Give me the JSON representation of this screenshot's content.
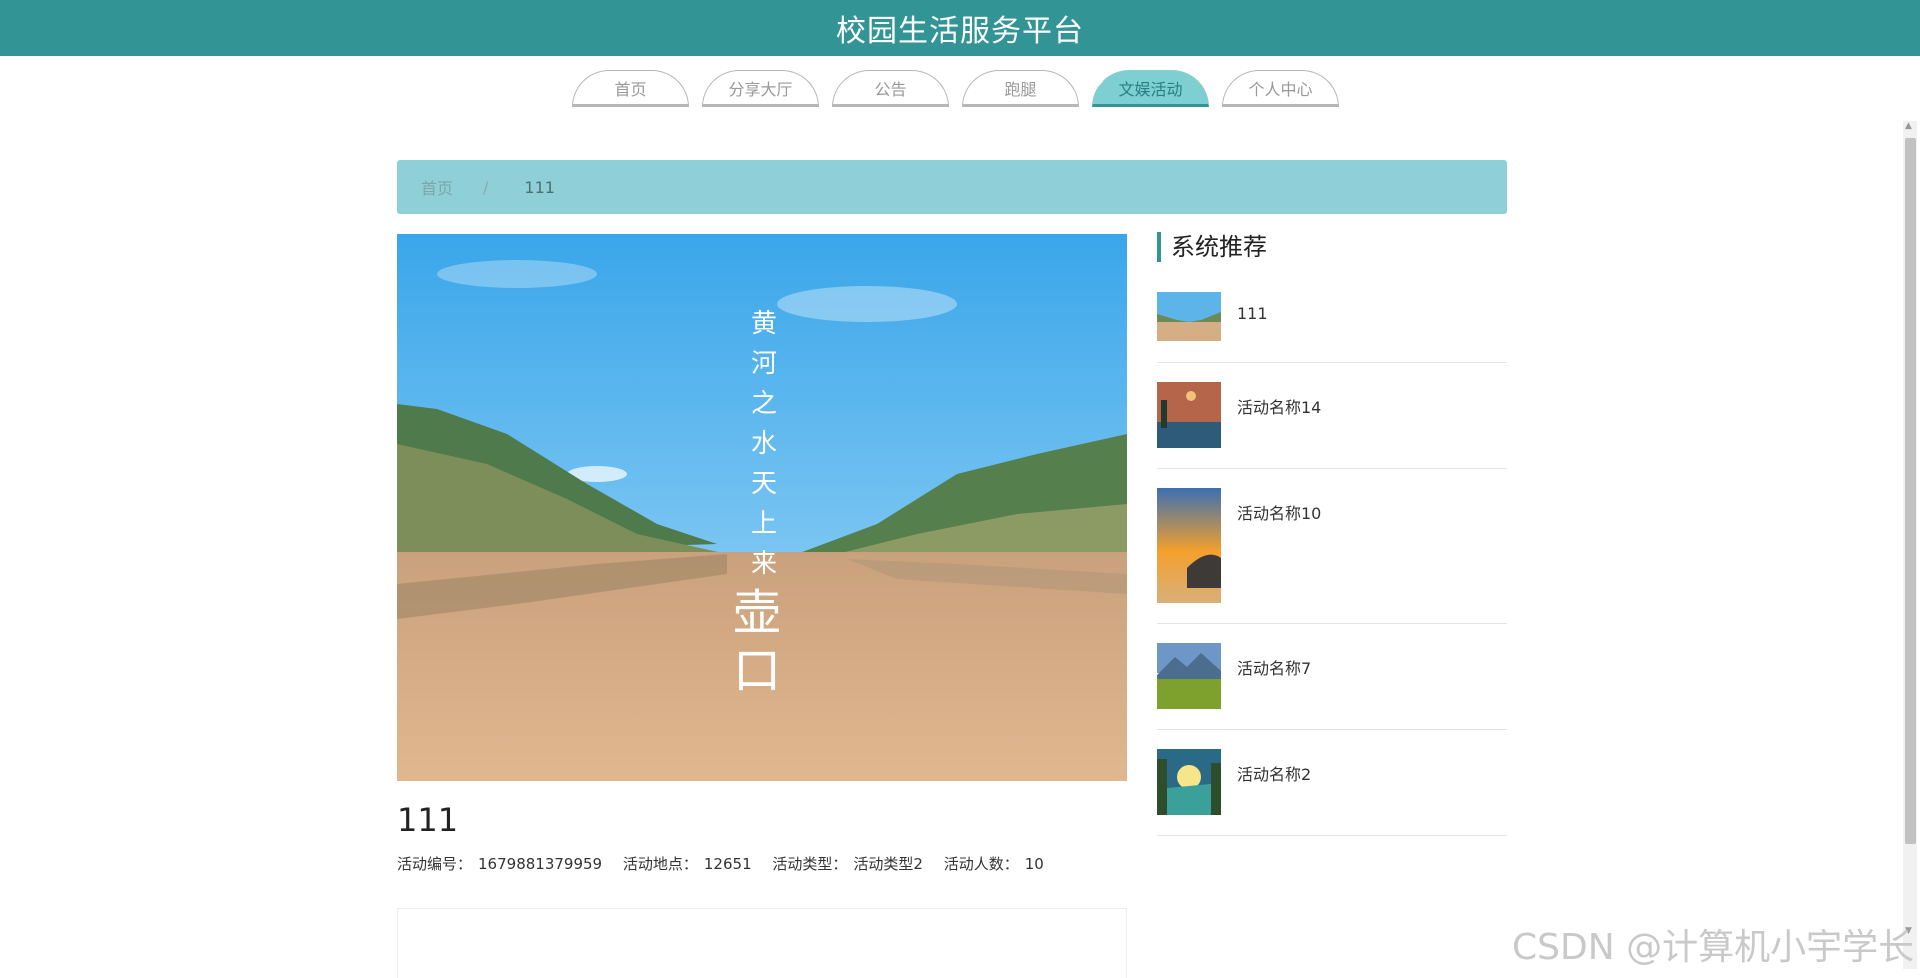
{
  "header": {
    "title": "校园生活服务平台"
  },
  "nav": {
    "tabs": [
      {
        "label": "首页"
      },
      {
        "label": "分享大厅"
      },
      {
        "label": "公告"
      },
      {
        "label": "跑腿"
      },
      {
        "label": "文娱活动",
        "active": true
      },
      {
        "label": "个人中心"
      }
    ]
  },
  "breadcrumb": {
    "home": "首页",
    "separator": "/",
    "current": "111"
  },
  "hero": {
    "poem": [
      "黄",
      "河",
      "之",
      "水",
      "天",
      "上",
      "来"
    ],
    "calligraphy": [
      "壶",
      "口"
    ]
  },
  "detail": {
    "title": "111",
    "meta": [
      {
        "label": "活动编号：",
        "value": "1679881379959"
      },
      {
        "label": "活动地点：",
        "value": "12651"
      },
      {
        "label": "活动类型：",
        "value": "活动类型2"
      },
      {
        "label": "活动人数：",
        "value": "10"
      }
    ]
  },
  "sidebar": {
    "title": "系统推荐",
    "items": [
      {
        "label": "111",
        "thumb": "river-valley"
      },
      {
        "label": "活动名称14",
        "thumb": "sunset-lake"
      },
      {
        "label": "活动名称10",
        "thumb": "rainbow-beach"
      },
      {
        "label": "活动名称7",
        "thumb": "mountain-meadow"
      },
      {
        "label": "活动名称2",
        "thumb": "sunrise-valley"
      }
    ]
  },
  "watermark": "CSDN @计算机小宇学长",
  "colors": {
    "header": "#339496",
    "breadcrumb": "#8fd0d8",
    "active_tab": "#7ecfd1"
  }
}
